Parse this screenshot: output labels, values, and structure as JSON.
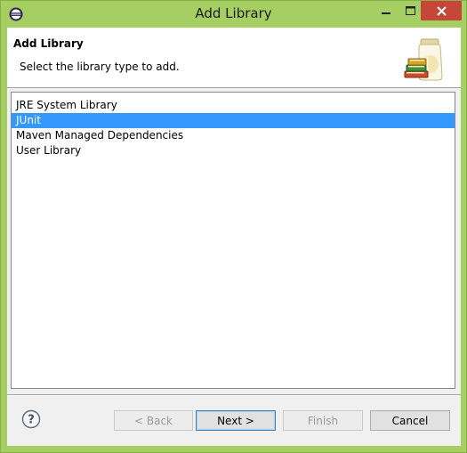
{
  "window": {
    "title": "Add Library",
    "accent_color": "#a6cf63",
    "close_color": "#c7463a"
  },
  "icons": {
    "app": "eclipse-icon",
    "minimize": "minimize-icon",
    "maximize": "maximize-icon",
    "close": "close-icon",
    "banner": "library-jar-icon",
    "help": "help-icon"
  },
  "banner": {
    "title": "Add Library",
    "subtitle": "Select the library type to add."
  },
  "library_types": {
    "items": [
      "JRE System Library",
      "JUnit",
      "Maven Managed Dependencies",
      "User Library"
    ],
    "selected": "JUnit",
    "selection_color": "#3399ff"
  },
  "buttons": {
    "back": "< Back",
    "next": "Next >",
    "finish": "Finish",
    "cancel": "Cancel"
  }
}
